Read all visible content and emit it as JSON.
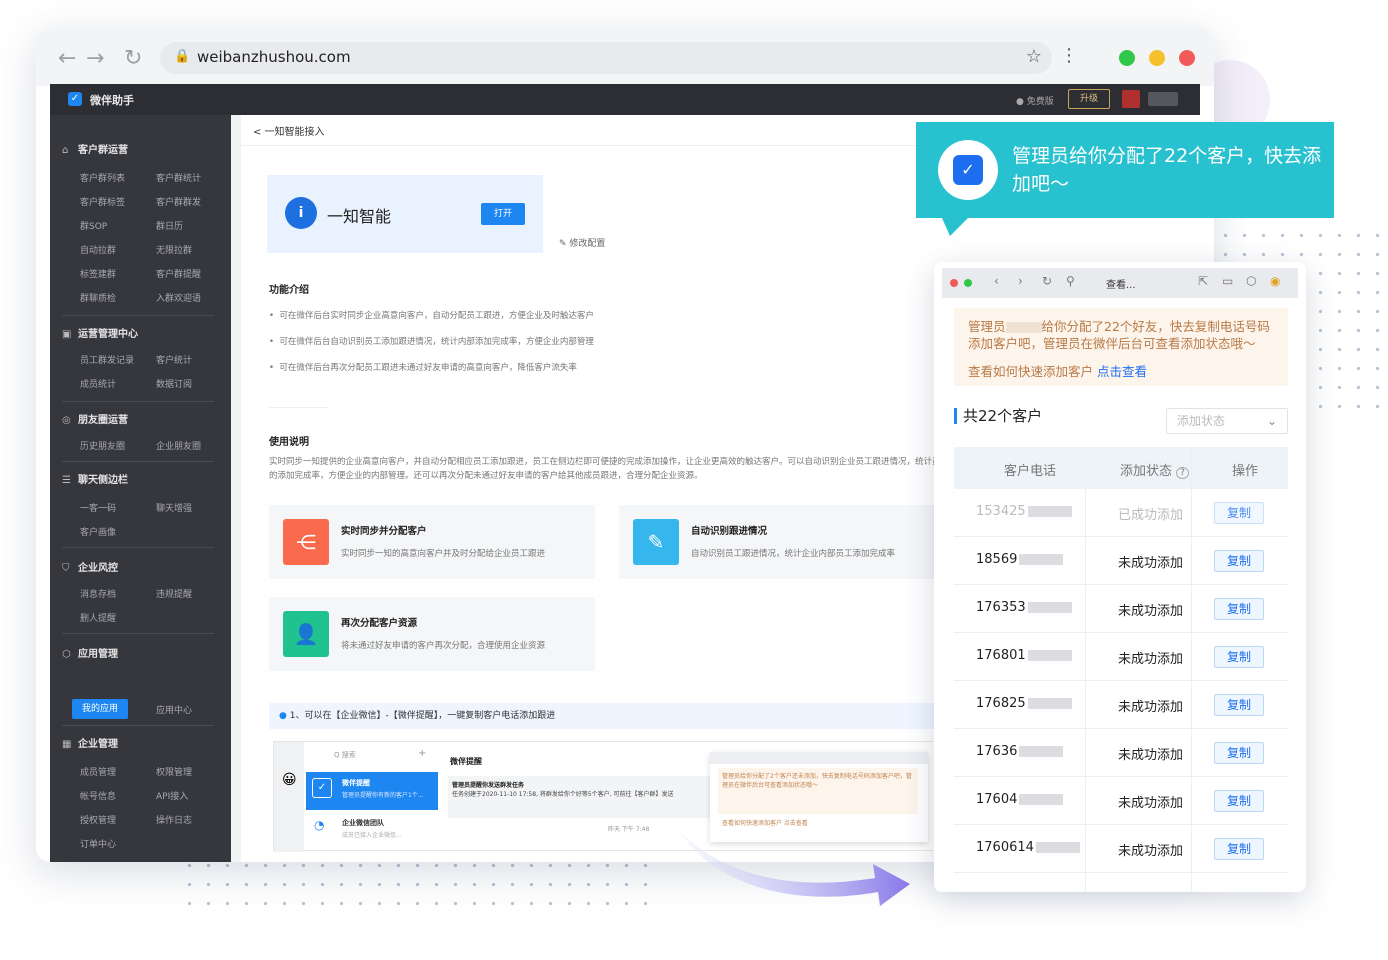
{
  "browser": {
    "url": "weibanzhushou.com",
    "nav_back": "←",
    "nav_forward": "→",
    "nav_reload": "↻"
  },
  "topbar": {
    "brand": "微伴助手",
    "free_label": "● 免费版",
    "upgrade_label": "升级"
  },
  "sidebar": {
    "sections": [
      {
        "title": "客户群运营",
        "items": [
          "客户群列表",
          "客户群统计",
          "客户群标签",
          "客户群群发",
          "群SOP",
          "群日历",
          "自动拉群",
          "无限拉群",
          "标签建群",
          "客户群提醒",
          "群聊质检",
          "入群欢迎语"
        ]
      },
      {
        "title": "运营管理中心",
        "items": [
          "员工群发记录",
          "客户统计",
          "成员统计",
          "数据订阅"
        ]
      },
      {
        "title": "朋友圈运营",
        "items": [
          "历史朋友圈",
          "企业朋友圈"
        ]
      },
      {
        "title": "聊天侧边栏",
        "items": [
          "一客一码",
          "聊天增强",
          "客户画像"
        ]
      },
      {
        "title": "企业风控",
        "items": [
          "消息存档",
          "违规提醒",
          "删人提醒"
        ]
      },
      {
        "title": "应用管理",
        "items": [
          "我的应用",
          "应用中心"
        ]
      },
      {
        "title": "企业管理",
        "items": [
          "成员管理",
          "权限管理",
          "帐号信息",
          "API接入",
          "授权管理",
          "操作日志",
          "订单中心"
        ]
      }
    ]
  },
  "main": {
    "breadcrumb": "< 一知智能接入",
    "app_name": "一知智能",
    "open_label": "打开",
    "modify_label": "修改配置",
    "intro_title": "功能介绍",
    "intro_items": [
      "可在微伴后台实时同步企业高意向客户，自动分配员工跟进，方便企业及时触达客户",
      "可在微伴后台自动识别员工添加跟进情况，统计内部添加完成率，方便企业内部管理",
      "可在微伴后台再次分配员工跟进未通过好友申请的高意向客户，降低客户流失率"
    ],
    "usage_title": "使用说明",
    "usage_text": "实时同步一知提供的企业高意向客户，并自动分配相应员工添加跟进，员工在侧边栏即可便捷的完成添加操作，让企业更高效的触达客户。可以自动识别企业员工跟进情况，统计员工的添加完成率，方便企业的内部管理。还可以再次分配未通过好友申请的客户给其他成员跟进，合理分配企业资源。",
    "features": [
      {
        "title": "实时同步并分配客户",
        "desc": "实时同步一知的高意向客户并及时分配给企业员工跟进"
      },
      {
        "title": "自动识别跟进情况",
        "desc": "自动识别员工跟进情况，统计企业内部员工添加完成率"
      },
      {
        "title": "再次分配客户资源",
        "desc": "将未通过好友申请的客户再次分配，合理使用企业资源"
      }
    ],
    "tip": "1、可以在【企业微信】-【微伴提醒】，一键复制客户电话添加跟进",
    "mini": {
      "search": "Q 搜索",
      "chat_title": "微伴提醒",
      "chat_item": "微伴提醒",
      "chat_item_sub": "管理员提醒你有新的客户1个...",
      "chat_item2": "企业微信团队",
      "chat_item2_sub": "成员已接入企业微信...",
      "msg_title": "管理员提醒你发送群发任务",
      "msg_body": "任务创建于2020-11-10 17:58, 将群发给你个好等5个客户, 可前往【客户群】发送",
      "msg_time": "昨天 下午 7:48",
      "mini_notice": "管理员给你分配了2个客户还未添加，快去复制电话号码添加客户吧，管理员在微伴后台可查看添加状态哦～",
      "mini_link": "查看如何快速添加客户 点击查看"
    }
  },
  "bubble": {
    "text": "管理员给你分配了22个客户，快去添加吧～"
  },
  "panel": {
    "toolbar_title": "查看...",
    "notice_prefix": "管理员",
    "notice_text": "给你分配了22个好友，快去复制电话号码添加客户吧，管理员在微伴后台可查看添加状态哦～",
    "notice_link_text": "查看如何快速添加客户",
    "notice_link": "点击查看",
    "total": "共22个客户",
    "filter_placeholder": "添加状态",
    "columns": [
      "客户电话",
      "添加状态",
      "操作"
    ],
    "status_info_icon": "?",
    "rows": [
      {
        "phone": "153425",
        "status": "已成功添加",
        "action": "复制"
      },
      {
        "phone": "18569",
        "status": "未成功添加",
        "action": "复制"
      },
      {
        "phone": "176353",
        "status": "未成功添加",
        "action": "复制"
      },
      {
        "phone": "176801",
        "status": "未成功添加",
        "action": "复制"
      },
      {
        "phone": "176825",
        "status": "未成功添加",
        "action": "复制"
      },
      {
        "phone": "17636",
        "status": "未成功添加",
        "action": "复制"
      },
      {
        "phone": "17604",
        "status": "未成功添加",
        "action": "复制"
      },
      {
        "phone": "1760614",
        "status": "未成功添加",
        "action": "复制"
      }
    ]
  },
  "colors": {
    "accent": "#1d86f0",
    "bubble": "#27c1cf",
    "sidebar": "#36373d",
    "notice_text": "#b87a45"
  }
}
